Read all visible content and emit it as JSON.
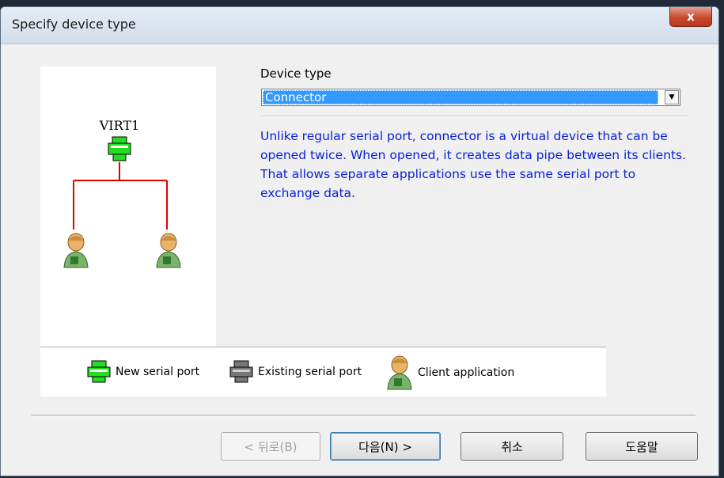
{
  "window": {
    "title": "Specify device type",
    "close_label": "x"
  },
  "diagram": {
    "device_name": "VIRT1",
    "icons": [
      "new-serial-port-icon",
      "client-application-icon",
      "client-application-icon"
    ],
    "line_color": "#e00000"
  },
  "device_type": {
    "label": "Device type",
    "selected": "Connector"
  },
  "description": "Unlike regular serial port, connector is a virtual device that can be opened twice. When opened, it creates data pipe between its clients. That allows separate applications use the same serial port to exchange data.",
  "legend": {
    "new_serial_port": "New serial port",
    "existing_serial_port": "Existing serial port",
    "client_application": "Client application"
  },
  "buttons": {
    "back": "< 뒤로(B)",
    "next": "다음(N) >",
    "cancel": "취소",
    "help": "도움말"
  },
  "colors": {
    "accent_select": "#3399ff",
    "description_text": "#0a20d8",
    "new_port_green": "#22dd22",
    "existing_port_gray": "#777777"
  }
}
